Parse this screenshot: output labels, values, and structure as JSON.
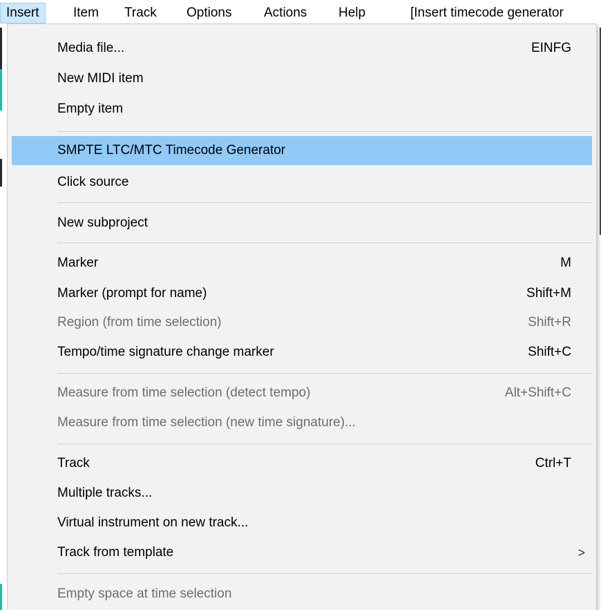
{
  "menubar": {
    "items": [
      {
        "label": "Insert"
      },
      {
        "label": "Item"
      },
      {
        "label": "Track"
      },
      {
        "label": "Options"
      },
      {
        "label": "Actions"
      },
      {
        "label": "Help"
      }
    ],
    "title": "[Insert timecode generator"
  },
  "menu": {
    "items": [
      {
        "label": "Media file...",
        "shortcut": "EINFG",
        "enabled": true
      },
      {
        "label": "New MIDI item",
        "shortcut": "",
        "enabled": true
      },
      {
        "label": "Empty item",
        "shortcut": "",
        "enabled": true
      },
      {
        "label": "SMPTE LTC/MTC Timecode Generator",
        "shortcut": "",
        "enabled": true,
        "highlighted": true
      },
      {
        "label": "Click source",
        "shortcut": "",
        "enabled": true
      },
      {
        "label": "New subproject",
        "shortcut": "",
        "enabled": true
      },
      {
        "label": "Marker",
        "shortcut": "M",
        "enabled": true
      },
      {
        "label": "Marker (prompt for name)",
        "shortcut": "Shift+M",
        "enabled": true
      },
      {
        "label": "Region (from time selection)",
        "shortcut": "Shift+R",
        "enabled": false
      },
      {
        "label": "Tempo/time signature change marker",
        "shortcut": "Shift+C",
        "enabled": true
      },
      {
        "label": "Measure from time selection (detect tempo)",
        "shortcut": "Alt+Shift+C",
        "enabled": false
      },
      {
        "label": "Measure from time selection (new time signature)...",
        "shortcut": "",
        "enabled": false
      },
      {
        "label": "Track",
        "shortcut": "Ctrl+T",
        "enabled": true
      },
      {
        "label": "Multiple tracks...",
        "shortcut": "",
        "enabled": true
      },
      {
        "label": "Virtual instrument on new track...",
        "shortcut": "",
        "enabled": true
      },
      {
        "label": "Track from template",
        "shortcut": "",
        "enabled": true,
        "submenu_arrow": ">"
      },
      {
        "label": "Empty space at time selection",
        "shortcut": "",
        "enabled": false
      }
    ]
  },
  "colors": {
    "highlight": "#91c9f7",
    "active_menubar": "#cce8ff",
    "menu_bg": "#f2f2f2",
    "disabled_text": "#6d6d6d"
  }
}
